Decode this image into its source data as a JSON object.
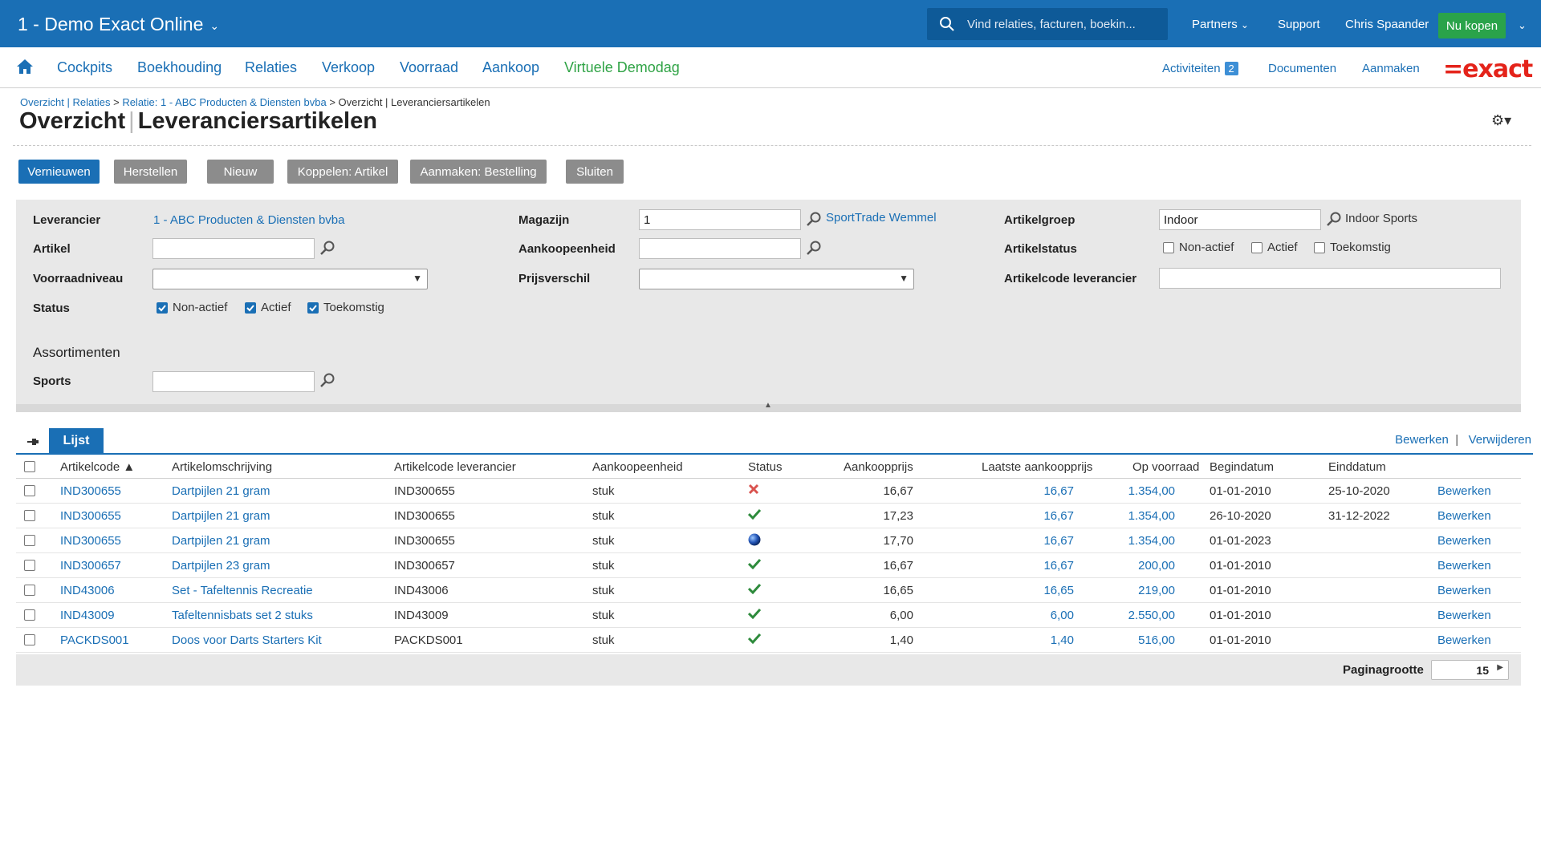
{
  "topbar": {
    "app_title": "1 - Demo Exact Online",
    "search_placeholder": "Vind relaties, facturen, boekin...",
    "partners": "Partners",
    "support": "Support",
    "user": "Chris Spaander",
    "buy": "Nu kopen"
  },
  "nav": {
    "items": [
      "Cockpits",
      "Boekhouding",
      "Relaties",
      "Verkoop",
      "Voorraad",
      "Aankoop",
      "Virtuele Demodag"
    ],
    "activities": "Activiteiten",
    "activities_count": "2",
    "documents": "Documenten",
    "create": "Aanmaken",
    "logo": "=exact"
  },
  "breadcrumb": {
    "part1": "Overzicht | Relaties",
    "part2": "Relatie: 1 - ABC Producten & Diensten bvba",
    "current": "Overzicht | Leveranciersartikelen"
  },
  "title": {
    "left": "Overzicht",
    "right": "Leveranciersartikelen"
  },
  "actions": {
    "refresh": "Vernieuwen",
    "reset": "Herstellen",
    "new": "Nieuw",
    "link_item": "Koppelen: Artikel",
    "create_order": "Aanmaken: Bestelling",
    "close": "Sluiten"
  },
  "filters": {
    "supplier_label": "Leverancier",
    "supplier_value": "1 - ABC Producten & Diensten bvba",
    "item_label": "Artikel",
    "stock_level_label": "Voorraadniveau",
    "status_label": "Status",
    "status_options": [
      "Non-actief",
      "Actief",
      "Toekomstig"
    ],
    "warehouse_label": "Magazijn",
    "warehouse_value": "1",
    "warehouse_name": "SportTrade Wemmel",
    "purchase_unit_label": "Aankoopeenheid",
    "price_diff_label": "Prijsverschil",
    "item_group_label": "Artikelgroep",
    "item_group_value": "Indoor",
    "item_group_name": "Indoor Sports",
    "item_status_label": "Artikelstatus",
    "item_status_options": [
      "Non-actief",
      "Actief",
      "Toekomstig"
    ],
    "supplier_code_label": "Artikelcode leverancier",
    "assortments_label": "Assortimenten",
    "sports_label": "Sports"
  },
  "list": {
    "tab": "Lijst",
    "edit": "Bewerken",
    "delete": "Verwijderen",
    "columns": [
      "Artikelcode ▲",
      "Artikelomschrijving",
      "Artikelcode leverancier",
      "Aankoopeenheid",
      "Status",
      "Aankoopprijs",
      "Laatste aankoopprijs",
      "Op voorraad",
      "Begindatum",
      "Einddatum"
    ],
    "rows": [
      {
        "code": "IND300655",
        "desc": "Dartpijlen 21 gram",
        "supcode": "IND300655",
        "unit": "stuk",
        "status": "inactive",
        "price": "16,67",
        "last": "16,67",
        "stock": "1.354,00",
        "start": "01-01-2010",
        "end": "25-10-2020",
        "action": "Bewerken"
      },
      {
        "code": "IND300655",
        "desc": "Dartpijlen 21 gram",
        "supcode": "IND300655",
        "unit": "stuk",
        "status": "active",
        "price": "17,23",
        "last": "16,67",
        "stock": "1.354,00",
        "start": "26-10-2020",
        "end": "31-12-2022",
        "action": "Bewerken"
      },
      {
        "code": "IND300655",
        "desc": "Dartpijlen 21 gram",
        "supcode": "IND300655",
        "unit": "stuk",
        "status": "future",
        "price": "17,70",
        "last": "16,67",
        "stock": "1.354,00",
        "start": "01-01-2023",
        "end": "",
        "action": "Bewerken"
      },
      {
        "code": "IND300657",
        "desc": "Dartpijlen 23 gram",
        "supcode": "IND300657",
        "unit": "stuk",
        "status": "active",
        "price": "16,67",
        "last": "16,67",
        "stock": "200,00",
        "start": "01-01-2010",
        "end": "",
        "action": "Bewerken"
      },
      {
        "code": "IND43006",
        "desc": "Set - Tafeltennis Recreatie",
        "supcode": "IND43006",
        "unit": "stuk",
        "status": "active",
        "price": "16,65",
        "last": "16,65",
        "stock": "219,00",
        "start": "01-01-2010",
        "end": "",
        "action": "Bewerken"
      },
      {
        "code": "IND43009",
        "desc": "Tafeltennisbats set 2 stuks",
        "supcode": "IND43009",
        "unit": "stuk",
        "status": "active",
        "price": "6,00",
        "last": "6,00",
        "stock": "2.550,00",
        "start": "01-01-2010",
        "end": "",
        "action": "Bewerken"
      },
      {
        "code": "PACKDS001",
        "desc": "Doos voor Darts Starters Kit",
        "supcode": "PACKDS001",
        "unit": "stuk",
        "status": "active",
        "price": "1,40",
        "last": "1,40",
        "stock": "516,00",
        "start": "01-01-2010",
        "end": "",
        "action": "Bewerken"
      }
    ],
    "page_size_label": "Paginagrootte",
    "page_size": "15"
  }
}
